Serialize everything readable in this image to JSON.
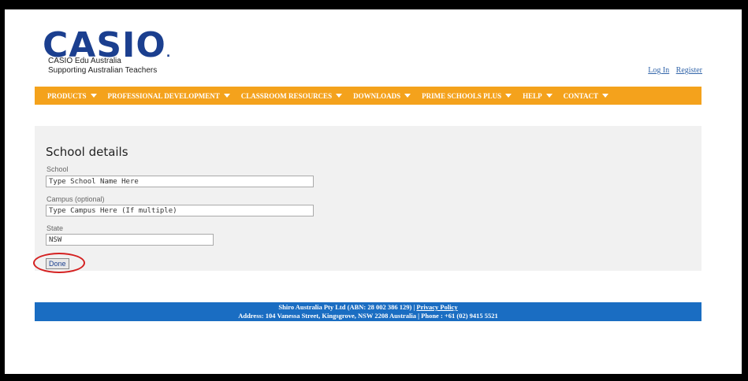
{
  "brand": {
    "logo_text": "CASIO",
    "logo_dot": ".",
    "line1": "CASIO Edu Australia",
    "line2": "Supporting Australian Teachers"
  },
  "auth": {
    "login": "Log In",
    "register": "Register"
  },
  "menu": {
    "items": [
      "PRODUCTS",
      "PROFESSIONAL DEVELOPMENT",
      "CLASSROOM RESOURCES",
      "DOWNLOADS",
      "PRIME SCHOOLS PLUS",
      "HELP",
      "CONTACT"
    ]
  },
  "form": {
    "title": "School details",
    "school_label": "School",
    "school_value": "Type School Name Here",
    "campus_label": "Campus (optional)",
    "campus_value": "Type Campus Here (If multiple)",
    "state_label": "State",
    "state_value": "NSW",
    "done_label": "Done"
  },
  "footer": {
    "line1_text": "Shiro Australia Pty Ltd (ABN: 28 002 386 129) |",
    "privacy_link": "Privacy Policy",
    "line2_text": "Address: 104 Vanessa Street, Kingsgrove, NSW 2208 Australia | Phone : +61 (02) 9415 5521"
  },
  "colors": {
    "brand_blue": "#1b3f8f",
    "menu_orange": "#f4a21c",
    "footer_blue": "#1a6dc2",
    "highlight_red": "#d42020"
  }
}
